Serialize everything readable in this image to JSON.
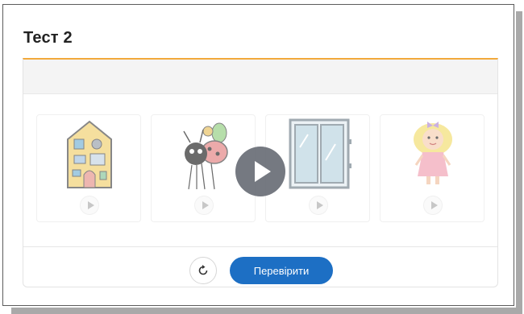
{
  "page": {
    "title": "Тест 2"
  },
  "tiles": [
    {
      "name": "house-illustration",
      "icon": "play-icon"
    },
    {
      "name": "ladybug-illustration",
      "icon": "play-icon"
    },
    {
      "name": "window-illustration",
      "icon": "play-icon"
    },
    {
      "name": "doll-illustration",
      "icon": "play-icon"
    }
  ],
  "video": {
    "icon": "play-icon"
  },
  "controls": {
    "reset_icon": "refresh-icon",
    "check_label": "Перевірити"
  },
  "colors": {
    "accent_line": "#f2a93b",
    "primary_button": "#1d6fc4",
    "video_overlay": "#6b6f78"
  }
}
